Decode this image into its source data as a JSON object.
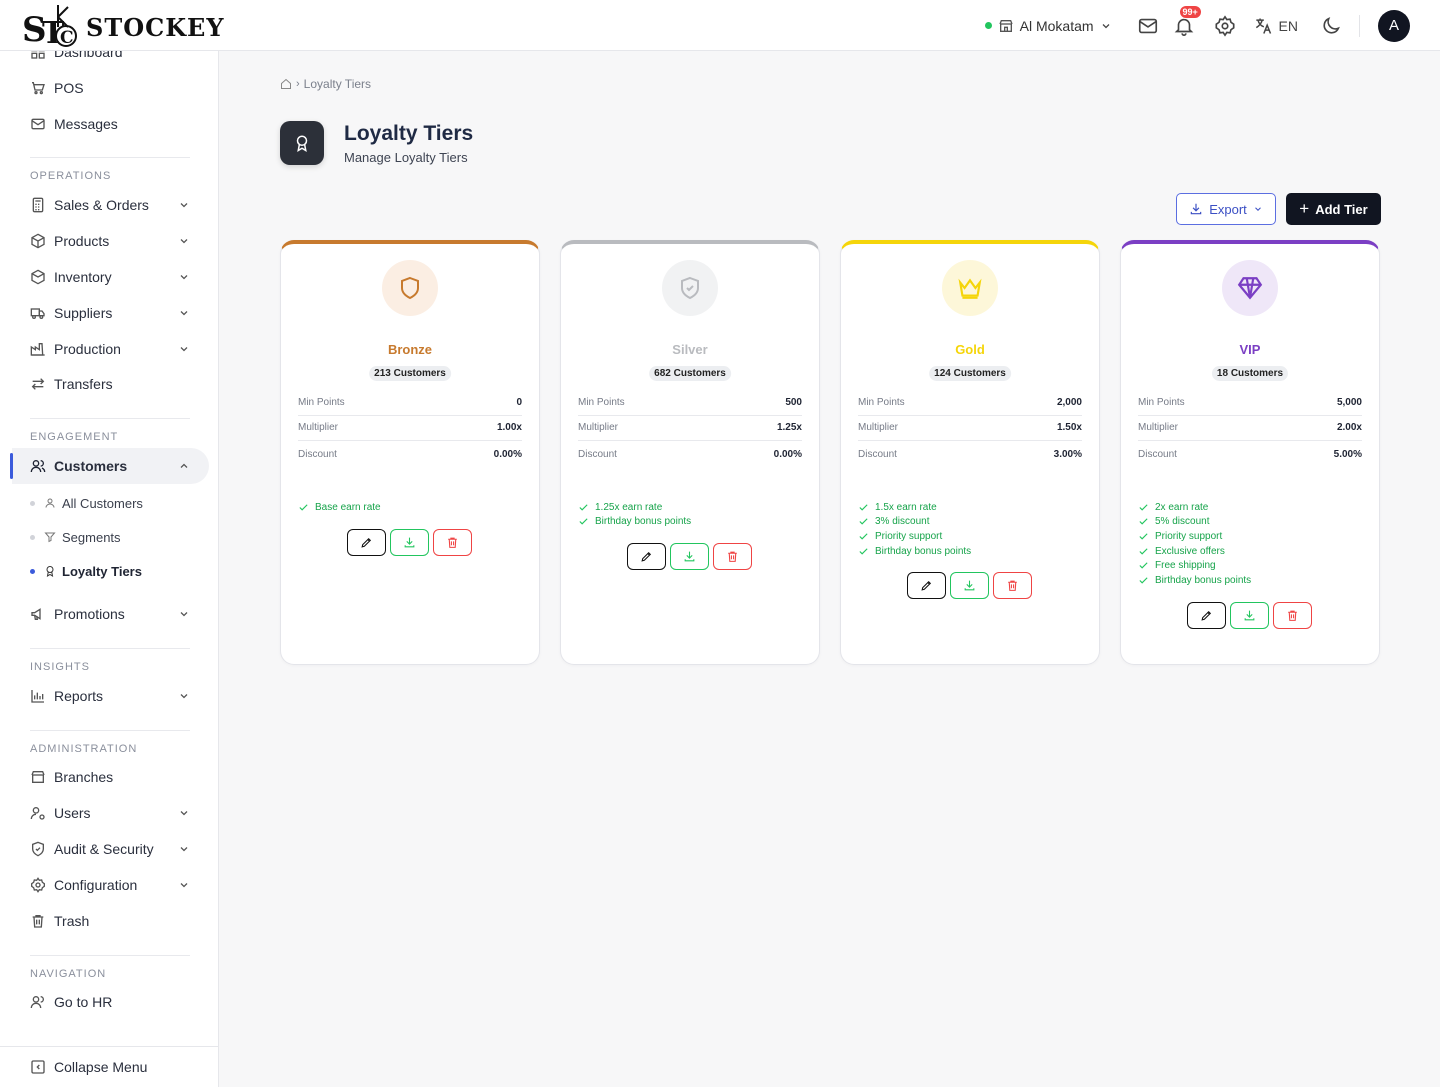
{
  "app": {
    "logo_text": "STOCKEY",
    "logo_mark": "STC"
  },
  "header": {
    "branch": "Al Mokatam",
    "notification_count": "99+",
    "language": "EN",
    "avatar_initial": "A"
  },
  "sidebar": {
    "top_items": [
      "Dashboard",
      "POS",
      "Messages"
    ],
    "sections": {
      "operations": "OPERATIONS",
      "engagement": "ENGAGEMENT",
      "insights": "INSIGHTS",
      "administration": "ADMINISTRATION",
      "navigation": "NAVIGATION"
    },
    "operations": [
      "Sales & Orders",
      "Products",
      "Inventory",
      "Suppliers",
      "Production",
      "Transfers"
    ],
    "engagement": {
      "customers": "Customers",
      "sub": [
        "All Customers",
        "Segments",
        "Loyalty Tiers"
      ],
      "promotions": "Promotions"
    },
    "insights": [
      "Reports"
    ],
    "administration": [
      "Branches",
      "Users",
      "Audit & Security",
      "Configuration",
      "Trash"
    ],
    "navigation": [
      "Go to HR"
    ],
    "collapse": "Collapse Menu"
  },
  "breadcrumb": {
    "current": "Loyalty Tiers"
  },
  "page": {
    "title": "Loyalty Tiers",
    "subtitle": "Manage Loyalty Tiers"
  },
  "toolbar": {
    "export_label": "Export",
    "add_label": "Add Tier"
  },
  "stat_labels": {
    "min_points": "Min Points",
    "multiplier": "Multiplier",
    "discount": "Discount"
  },
  "tiers": [
    {
      "name": "Bronze",
      "customers": "213 Customers",
      "min_points": "0",
      "multiplier": "1.00x",
      "discount": "0.00%",
      "color": "#c77a2e",
      "icon_bg": "#fbeee3",
      "icon": "shield-icon",
      "features": [
        "Base earn rate"
      ]
    },
    {
      "name": "Silver",
      "customers": "682 Customers",
      "min_points": "500",
      "multiplier": "1.25x",
      "discount": "0.00%",
      "color": "#b9bbbf",
      "icon_bg": "#f1f2f3",
      "icon": "shield-check-icon",
      "features": [
        "1.25x earn rate",
        "Birthday bonus points"
      ]
    },
    {
      "name": "Gold",
      "customers": "124 Customers",
      "min_points": "2,000",
      "multiplier": "1.50x",
      "discount": "3.00%",
      "color": "#f5d50a",
      "icon_bg": "#fdf7d9",
      "icon": "crown-icon",
      "features": [
        "1.5x earn rate",
        "3% discount",
        "Priority support",
        "Birthday bonus points"
      ]
    },
    {
      "name": "VIP",
      "customers": "18 Customers",
      "min_points": "5,000",
      "multiplier": "2.00x",
      "discount": "5.00%",
      "color": "#7b3fc4",
      "icon_bg": "#efe7f8",
      "icon": "diamond-icon",
      "features": [
        "2x earn rate",
        "5% discount",
        "Priority support",
        "Exclusive offers",
        "Free shipping",
        "Birthday bonus points"
      ]
    }
  ]
}
